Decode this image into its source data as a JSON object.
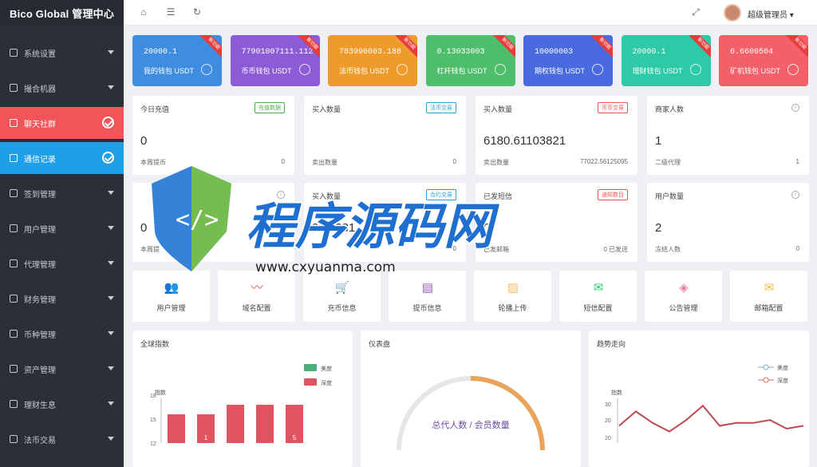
{
  "brand": "Bico Global 管理中心",
  "sidebar": {
    "items": [
      {
        "label": "系统设置",
        "icon": "sliders-icon"
      },
      {
        "label": "撮合机器",
        "icon": "robot-icon"
      },
      {
        "label": "聊天社群",
        "icon": "chat-icon"
      },
      {
        "label": "通信记录",
        "icon": "phone-icon"
      },
      {
        "label": "签到管理",
        "icon": "calendar-icon"
      },
      {
        "label": "用户管理",
        "icon": "user-icon"
      },
      {
        "label": "代理管理",
        "icon": "agent-icon"
      },
      {
        "label": "财务管理",
        "icon": "finance-icon"
      },
      {
        "label": "币种管理",
        "icon": "coin-icon"
      },
      {
        "label": "资产管理",
        "icon": "asset-icon"
      },
      {
        "label": "理财生息",
        "icon": "star-icon"
      },
      {
        "label": "法币交易",
        "icon": "trade-icon"
      }
    ]
  },
  "topbar": {
    "username": "超级管理员"
  },
  "cards": [
    {
      "num": "20000.1",
      "label": "我的钱包 USDT",
      "ribbon": "新功能",
      "color": "#3f8de0"
    },
    {
      "num": "77901007111.112",
      "label": "币币钱包 USDT",
      "ribbon": "新功能",
      "color": "#8c5bd6"
    },
    {
      "num": "783990003.188",
      "label": "法币钱包 USDT",
      "ribbon": "新功能",
      "color": "#ef9a2c"
    },
    {
      "num": "0.13033003",
      "label": "杠杆钱包 USDT",
      "ribbon": "新功能",
      "color": "#4fbe6c"
    },
    {
      "num": "10000003",
      "label": "期权钱包 USDT",
      "ribbon": "新功能",
      "color": "#4a6be0"
    },
    {
      "num": "20000.1",
      "label": "理财钱包 USDT",
      "ribbon": "新功能",
      "color": "#2ec9a6"
    },
    {
      "num": "6.6600504",
      "label": "矿机钱包 USDT",
      "ribbon": "新功能",
      "color": "#f2606a"
    }
  ],
  "stats_row1": [
    {
      "title": "今日充值",
      "tag": "充值数据",
      "tag_color": "#4caf50",
      "big": "0",
      "sub_label": "本周提币",
      "sub_value": "0"
    },
    {
      "title": "买入数量",
      "tag": "法币交易",
      "tag_color": "#29a3d8",
      "big": "",
      "sub_label": "卖出数量",
      "sub_value": "0"
    },
    {
      "title": "买入数量",
      "tag": "币币交易",
      "tag_color": "#f0555a",
      "big": "6180.61103821",
      "sub_label": "卖出数量",
      "sub_value": "77022.56125095"
    },
    {
      "title": "商家人数",
      "tag": "",
      "tag_color": "",
      "big": "1",
      "sub_label": "二级代理",
      "sub_value": "1"
    }
  ],
  "stats_row2": [
    {
      "title": "",
      "tag": "",
      "tag_color": "",
      "big": "0",
      "sub_label": "本周提",
      "sub_value": ""
    },
    {
      "title": "买入数量",
      "tag": "合约交易",
      "tag_color": "#29a3d8",
      "big": "287.281",
      "sub_label": "",
      "sub_value": "0"
    },
    {
      "title": "已发短信",
      "tag": "通知数目",
      "tag_color": "#f0555a",
      "big": "0",
      "sub_label": "已发邮箱",
      "sub_value": "0 已发送"
    },
    {
      "title": "用户数量",
      "tag": "",
      "tag_color": "",
      "big": "2",
      "sub_label": "冻结人数",
      "sub_value": "0"
    }
  ],
  "quick": [
    {
      "label": "用户管理",
      "icon": "users-icon",
      "glyph": "👥",
      "color": "#4a90d9"
    },
    {
      "label": "域名配置",
      "icon": "pulse-icon",
      "glyph": "〰",
      "color": "#e74c3c"
    },
    {
      "label": "充币信息",
      "icon": "cart-icon",
      "glyph": "🛒",
      "color": "#f0ad4e"
    },
    {
      "label": "提币信息",
      "icon": "doc-icon",
      "glyph": "▤",
      "color": "#9b59b6"
    },
    {
      "label": "轮播上传",
      "icon": "image-icon",
      "glyph": "▨",
      "color": "#f5c26b"
    },
    {
      "label": "短信配置",
      "icon": "message-icon",
      "glyph": "✉",
      "color": "#2ecc71"
    },
    {
      "label": "公告管理",
      "icon": "tag-icon",
      "glyph": "◈",
      "color": "#e67eaa"
    },
    {
      "label": "邮箱配置",
      "icon": "mail-icon",
      "glyph": "✉",
      "color": "#f0c040"
    }
  ],
  "panels": {
    "global": "全球指数",
    "gauge": "仪表盘",
    "gauge_text": "总代人数 / 会员数量",
    "trend": "趋势走向"
  },
  "watermark": {
    "title": "程序源码网",
    "url": "www.cxyuanma.com"
  },
  "chart_data": [
    {
      "type": "bar",
      "title": "全球指数",
      "ylabel": "指数",
      "legend": [
        "美度",
        "深度"
      ],
      "legend_placement": "top-right",
      "yticks": [
        "18",
        "15",
        "12"
      ],
      "ylim": [
        12,
        19
      ],
      "series": [
        {
          "name": "深度",
          "values": [
            15.6,
            15.6,
            16.8,
            16.8,
            16.8
          ]
        }
      ],
      "data_labels": [
        "",
        "1",
        "",
        "",
        "5"
      ]
    },
    {
      "type": "line",
      "title": "趋势走向",
      "ylabel": "指数",
      "legend": [
        "美度",
        "深度"
      ],
      "legend_placement": "top-right",
      "yticks": [
        "30",
        "20",
        "20"
      ],
      "series": [
        {
          "name": "深度",
          "values": [
            21,
            26,
            22,
            19,
            23,
            28,
            21,
            22,
            22,
            23,
            20,
            21
          ]
        }
      ]
    }
  ]
}
